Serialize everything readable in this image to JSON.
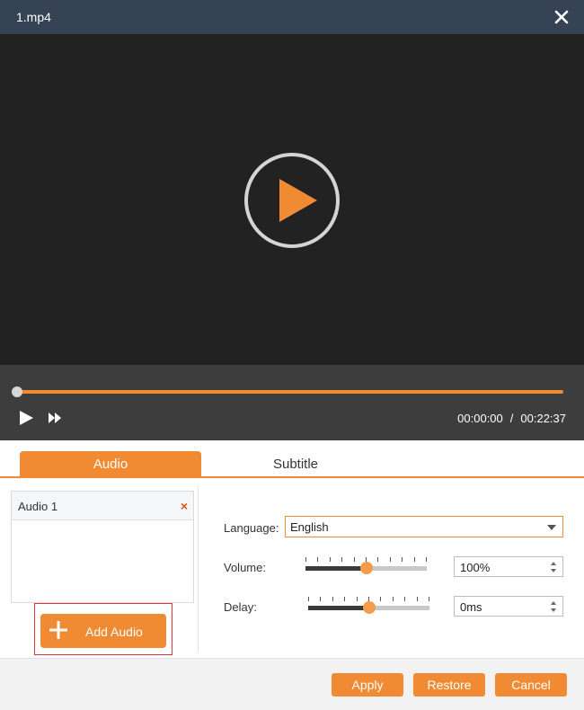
{
  "window": {
    "title": "1.mp4"
  },
  "player": {
    "current_time": "00:00:00",
    "separator": "/",
    "duration": "00:22:37",
    "progress": 0
  },
  "tabs": [
    {
      "label": "Audio",
      "active": true
    },
    {
      "label": "Subtitle",
      "active": false
    }
  ],
  "audio_tracks": [
    {
      "name": "Audio 1",
      "remove_glyph": "×"
    }
  ],
  "add_audio": {
    "label": "Add Audio"
  },
  "settings": {
    "language": {
      "label": "Language:",
      "value": "English"
    },
    "volume": {
      "label": "Volume:",
      "value": "100%",
      "level": 0.5
    },
    "delay": {
      "label": "Delay:",
      "value": "0ms",
      "level": 0.5
    }
  },
  "footer": {
    "apply": "Apply",
    "restore": "Restore",
    "cancel": "Cancel"
  },
  "colors": {
    "accent": "#f08a33",
    "titlebar": "#364354",
    "video_bg": "#222222",
    "controls_bg": "#3d3d3d"
  },
  "icons": {
    "close": "close-icon",
    "big_play": "play-circle-icon",
    "play": "play-icon",
    "fast_forward": "fast-forward-icon",
    "add": "plus-icon",
    "dropdown": "chevron-down-icon",
    "spinner": "spinner-arrows-icon"
  }
}
